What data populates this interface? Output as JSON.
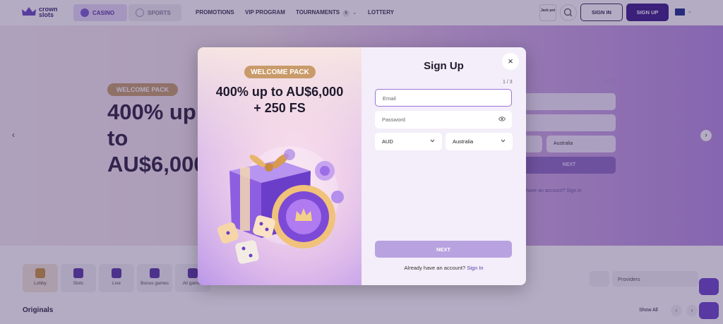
{
  "header": {
    "logo_text": "crown slots",
    "tabs": [
      {
        "label": "CASINO"
      },
      {
        "label": "SPORTS"
      }
    ],
    "nav": [
      {
        "label": "PROMOTIONS"
      },
      {
        "label": "VIP PROGRAM"
      },
      {
        "label": "TOURNAMENTS",
        "badge": "9"
      },
      {
        "label": "LOTTERY"
      }
    ],
    "jackpot_text": "Jack pot",
    "sign_in_label": "SIGN IN",
    "sign_up_label": "SIGN UP"
  },
  "hero": {
    "pill": "WELCOME PACK",
    "title": "400% up to AU$6,000 + 250 FS",
    "step": "1 / 3",
    "country": "Australia",
    "next": "NEXT",
    "account_prompt": "have an account?",
    "sign_in_link": "Sign in"
  },
  "categories": [
    {
      "label": "Lobby"
    },
    {
      "label": "Slots"
    },
    {
      "label": "Live"
    },
    {
      "label": "Bonus games"
    },
    {
      "label": "All games"
    }
  ],
  "providers_placeholder": "Providers",
  "originals": {
    "title": "Originals",
    "show_all": "Show All"
  },
  "modal": {
    "promo_pill": "WELCOME PACK",
    "promo_title_line1": "400% up to AU$6,000",
    "promo_title_line2": "+ 250 FS",
    "title": "Sign Up",
    "step": "1 / 3",
    "email_placeholder": "Email",
    "password_placeholder": "Password",
    "currency": "AUD",
    "country": "Australia",
    "next_label": "NEXT",
    "already_text": "Already have an account?",
    "sign_in_link": "Sign In",
    "close_icon": "close-icon"
  },
  "colors": {
    "brand_primary": "#3b1d8a",
    "accent_purple": "#5a3aa5",
    "gold": "#c99b6a",
    "next_disabled": "#b8a2df"
  }
}
